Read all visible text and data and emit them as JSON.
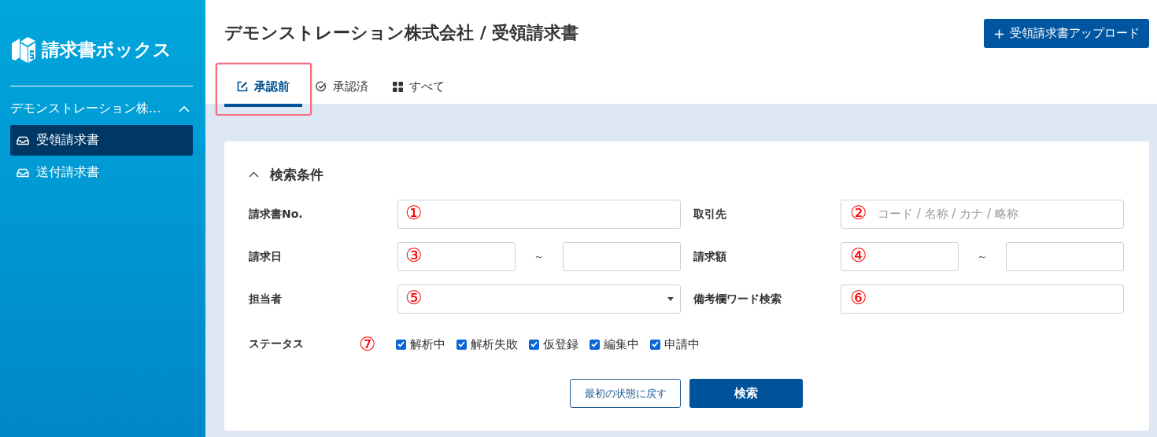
{
  "sidebar": {
    "logo": "請求書ボックス",
    "company": {
      "label": "デモンストレーション株...",
      "expanded": true
    },
    "items": [
      {
        "label": "受領請求書",
        "selected": true
      },
      {
        "label": "送付請求書",
        "selected": false
      }
    ]
  },
  "header": {
    "title": "デモンストレーション株式会社 / 受領請求書",
    "upload_button": {
      "icon": "+",
      "label": "受領請求書アップロード"
    }
  },
  "tabs": [
    {
      "label": "承認前",
      "kind": "edit",
      "selected": true,
      "highlighted": true
    },
    {
      "label": "承認済",
      "kind": "check",
      "selected": false,
      "highlighted": false
    },
    {
      "label": "すべて",
      "kind": "grid",
      "selected": false,
      "highlighted": false
    }
  ],
  "search": {
    "title": "検索条件",
    "expanded": true,
    "fields": [
      {
        "label": "請求書No.",
        "kind": "text",
        "marker": "①"
      },
      {
        "label": "取引先",
        "kind": "text",
        "marker": "②",
        "placeholder": "コード / 名称 / カナ / 略称"
      },
      {
        "label": "請求日",
        "kind": "range",
        "marker": "③",
        "separator": "~"
      },
      {
        "label": "請求額",
        "kind": "range",
        "marker": "④",
        "separator": "~"
      },
      {
        "label": "担当者",
        "kind": "select",
        "marker": "⑤"
      },
      {
        "label": "備考欄ワード検索",
        "kind": "text",
        "marker": "⑥"
      }
    ],
    "status": {
      "label": "ステータス",
      "marker": "⑦",
      "options": [
        {
          "label": "解析中",
          "checked": true
        },
        {
          "label": "解析失敗",
          "checked": true
        },
        {
          "label": "仮登録",
          "checked": true
        },
        {
          "label": "編集中",
          "checked": true
        },
        {
          "label": "申請中",
          "checked": true
        }
      ]
    },
    "reset_button": "最初の状態に戻す",
    "search_button": "検索"
  }
}
